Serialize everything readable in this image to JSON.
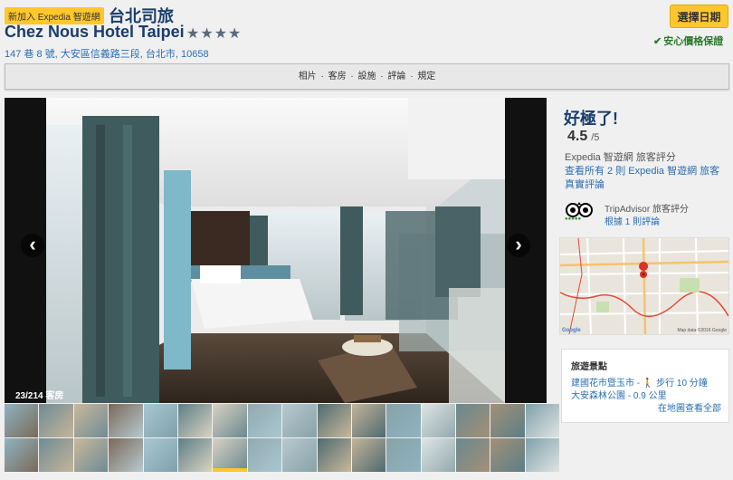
{
  "header": {
    "badge": "新加入 Expedia 智遊網",
    "name_cn": "台北司旅",
    "name_en": "Chez Nous Hotel Taipei",
    "stars": "★★★★",
    "address": "147 巷 8 號, 大安區信義路三段, 台北市, 10658",
    "select_button": "選擇日期",
    "secure_label": "安心價格保證",
    "check_icon": "✔"
  },
  "nav": {
    "items": [
      "相片",
      "客房",
      "設施",
      "評論",
      "規定"
    ],
    "separator": "·"
  },
  "gallery": {
    "counter": "23/214 客房",
    "prev_icon": "‹",
    "next_icon": "›",
    "thumbnail_count": 32,
    "selected_thumbnail": 22
  },
  "rating": {
    "heading": "好極了!",
    "score": "4.5",
    "out_of": "/5",
    "expedia_label": "Expedia 智遊網 旅客評分",
    "expedia_link": "查看所有 2 則 Expedia 智遊網 旅客真實評論",
    "tripadvisor_label": "TripAdvisor 旅客評分",
    "tripadvisor_link": "根據 1 則評論",
    "tripadvisor_dots": "●●●●●"
  },
  "map": {
    "footer_left": "Google",
    "footer_right": "Map data ©2016 Google"
  },
  "poi": {
    "title": "旅遊景點",
    "items": [
      "建國花市暨玉市 - 🚶 步行 10 分鐘",
      "大安森林公園 - 0.9 公里"
    ],
    "map_link": "在地圖查看全部"
  },
  "colors": {
    "brand_navy": "#1a3d6d",
    "accent_yellow": "#ffc72c",
    "link_blue": "#2a6db0",
    "secure_green": "#2c7a2c"
  }
}
